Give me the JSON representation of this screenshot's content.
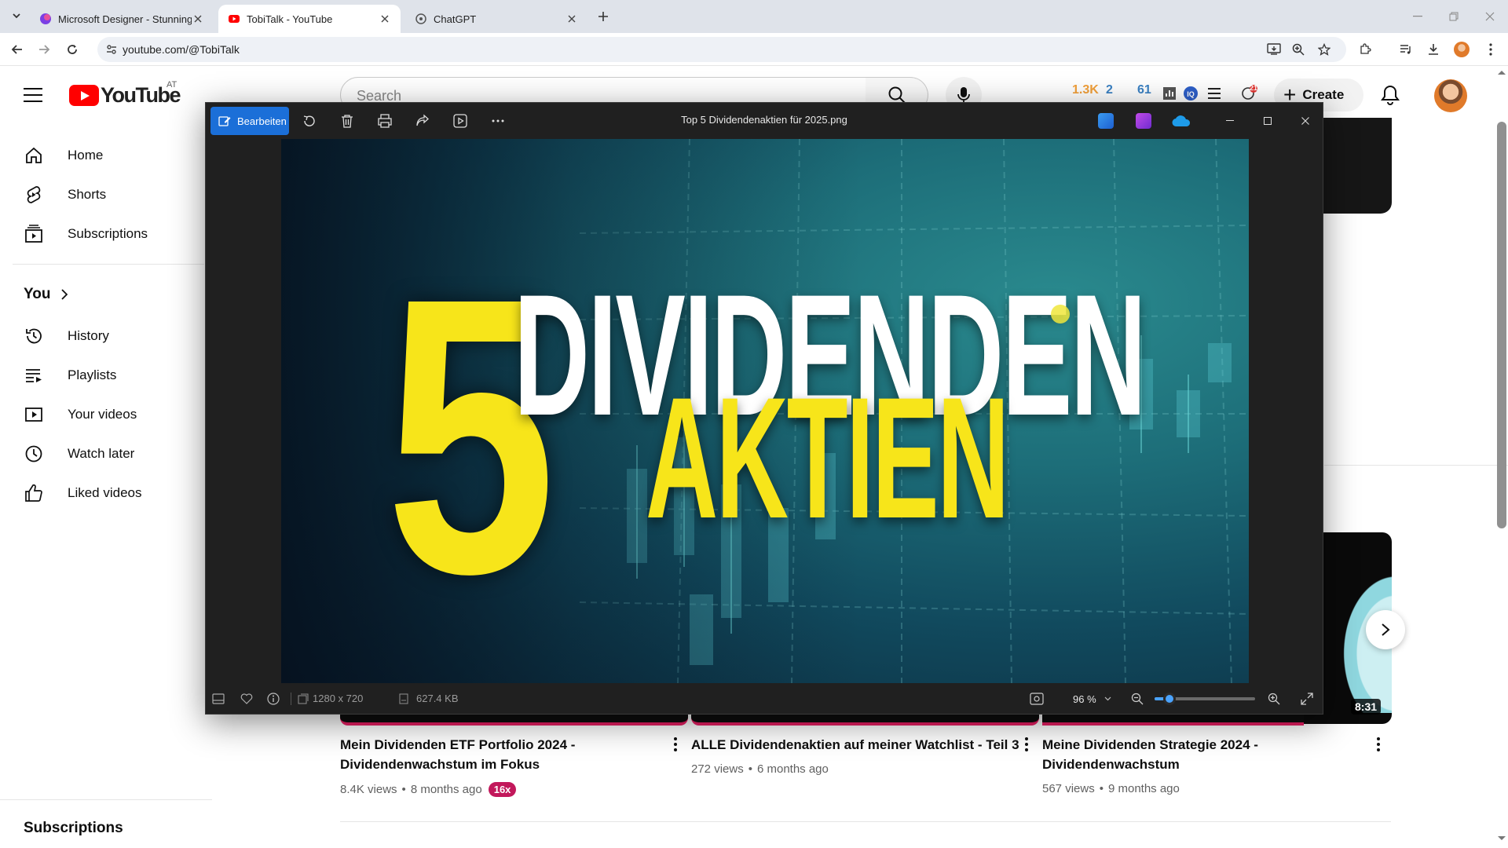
{
  "browser": {
    "tabs": [
      {
        "title": "Microsoft Designer - Stunning",
        "active": false
      },
      {
        "title": "TobiTalk - YouTube",
        "active": true
      },
      {
        "title": "ChatGPT",
        "active": false
      }
    ],
    "url": "youtube.com/@TobiTalk"
  },
  "youtube": {
    "logo_text": "YouTube",
    "country_code": "AT",
    "search_placeholder": "Search",
    "create_label": "Create",
    "extension": {
      "n1": "1.3K",
      "n2": "2",
      "n3": "61",
      "notify_count": "21"
    },
    "sidebar": {
      "top_items": [
        {
          "label": "Home",
          "icon": "home-icon"
        },
        {
          "label": "Shorts",
          "icon": "shorts-icon"
        },
        {
          "label": "Subscriptions",
          "icon": "subscriptions-icon"
        }
      ],
      "you_label": "You",
      "you_items": [
        {
          "label": "History",
          "icon": "history-icon"
        },
        {
          "label": "Playlists",
          "icon": "playlists-icon"
        },
        {
          "label": "Your videos",
          "icon": "your-videos-icon"
        },
        {
          "label": "Watch later",
          "icon": "watch-later-icon"
        },
        {
          "label": "Liked videos",
          "icon": "liked-videos-icon"
        }
      ],
      "subscriptions_heading": "Subscriptions"
    },
    "videos": [
      {
        "title_line1": "Mein Dividenden ETF Portfolio 2024 -",
        "title_line2": "Dividendenwachstum im Fokus",
        "views": "8.4K views",
        "age": "8 months ago",
        "badge": "16x"
      },
      {
        "title_line1": "ALLE Dividendenaktien auf meiner Watchlist - Teil 3",
        "title_line2": "",
        "views": "272 views",
        "age": "6 months ago"
      },
      {
        "title_line1": "Meine Dividenden Strategie 2024 -",
        "title_line2": "Dividendenwachstum",
        "views": "567 views",
        "age": "9 months ago",
        "duration": "8:31"
      }
    ]
  },
  "viewer": {
    "edit_label": "Bearbeiten",
    "filename": "Top 5 Dividendenaktien für 2025.png",
    "image_text": {
      "number": "5",
      "word1": "DIVIDENDEN",
      "word2": "AKTIEN"
    },
    "dimensions": "1280 x 720",
    "filesize": "627.4 KB",
    "zoom": "96 %",
    "zoom_level": 0.15
  }
}
